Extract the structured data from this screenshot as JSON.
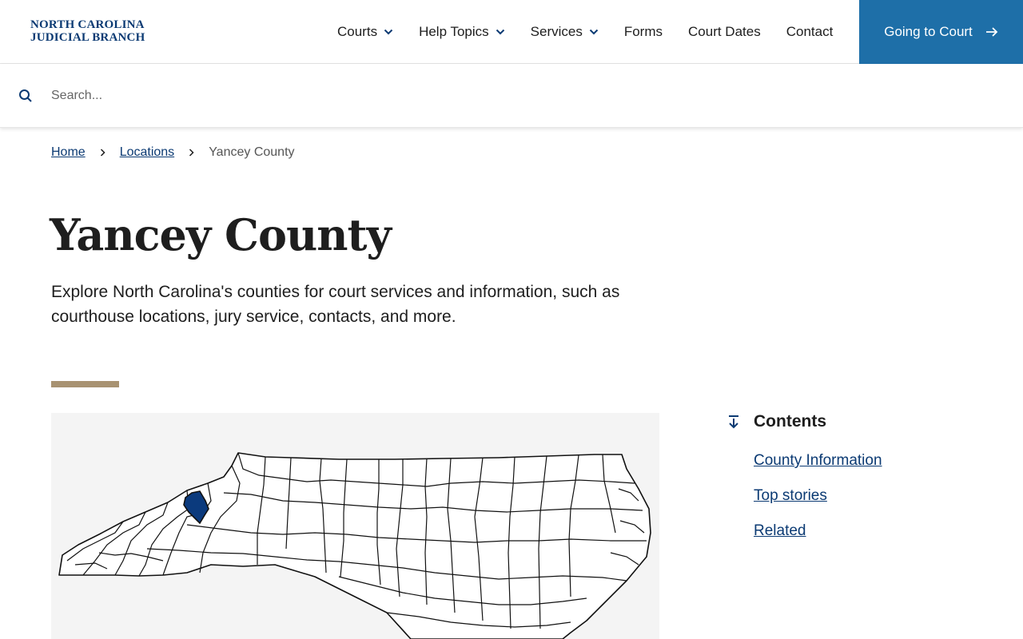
{
  "header": {
    "logo_line1": "NORTH CAROLINA",
    "logo_line2": "JUDICIAL BRANCH",
    "nav": [
      {
        "label": "Courts",
        "has_dropdown": true
      },
      {
        "label": "Help Topics",
        "has_dropdown": true
      },
      {
        "label": "Services",
        "has_dropdown": true
      },
      {
        "label": "Forms",
        "has_dropdown": false
      },
      {
        "label": "Court Dates",
        "has_dropdown": false
      },
      {
        "label": "Contact",
        "has_dropdown": false
      }
    ],
    "cta_label": "Going to Court"
  },
  "search": {
    "placeholder": "Search...",
    "value": ""
  },
  "breadcrumb": {
    "home": "Home",
    "locations": "Locations",
    "current": "Yancey County"
  },
  "page": {
    "title": "Yancey County",
    "intro": "Explore North Carolina's counties for court services and information, such as courthouse locations, jury service, contacts, and more."
  },
  "map": {
    "highlighted_county": "Yancey County"
  },
  "contents": {
    "heading": "Contents",
    "links": [
      "County Information",
      "Top stories",
      "Related"
    ]
  },
  "colors": {
    "brand_navy": "#0b3a73",
    "cta_blue": "#1e6fa8",
    "accent_tan": "#a89271",
    "map_background": "#f4f4f4",
    "highlight_county": "#0b3a7d"
  }
}
